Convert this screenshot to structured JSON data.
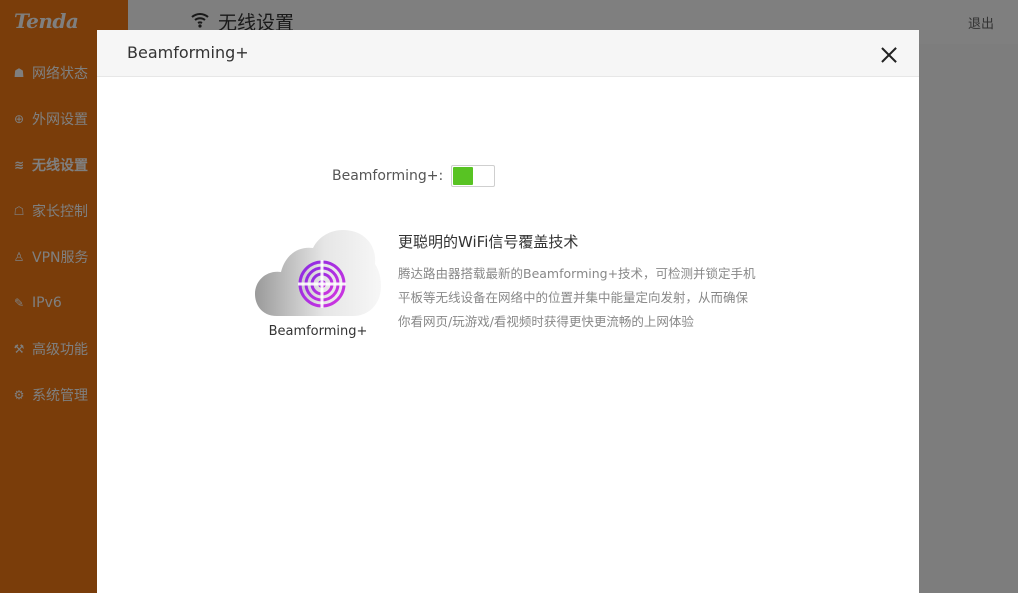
{
  "sidebar": {
    "logo": "Tenda",
    "items": [
      {
        "label": "网络状态",
        "icon": "network-status-icon",
        "glyph": "☗"
      },
      {
        "label": "外网设置",
        "icon": "globe-icon",
        "glyph": "⊕"
      },
      {
        "label": "无线设置",
        "icon": "wifi-icon",
        "glyph": "≋",
        "active": true
      },
      {
        "label": "家长控制",
        "icon": "parental-control-icon",
        "glyph": "☖"
      },
      {
        "label": "VPN服务",
        "icon": "vpn-icon",
        "glyph": "♙"
      },
      {
        "label": "IPv6",
        "icon": "ipv6-icon",
        "glyph": "✎"
      },
      {
        "label": "高级功能",
        "icon": "tools-icon",
        "glyph": "⚒"
      },
      {
        "label": "系统管理",
        "icon": "gear-icon",
        "glyph": "⚙"
      }
    ]
  },
  "header": {
    "title": "无线设置",
    "logout": "退出"
  },
  "modal": {
    "title": "Beamforming+",
    "toggle_label": "Beamforming+:",
    "toggle_state": "on",
    "icon_caption": "Beamforming+",
    "desc_title": "更聪明的WiFi信号覆盖技术",
    "desc_text": "腾达路由器搭载最新的Beamforming+技术，可检测并锁定手机平板等无线设备在网络中的位置并集中能量定向发射，从而确保你看网页/玩游戏/看视频时获得更快更流畅的上网体验"
  },
  "colors": {
    "brand": "#f57a14",
    "toggle_on": "#58c323",
    "beam_accent": "#b32ae8"
  }
}
